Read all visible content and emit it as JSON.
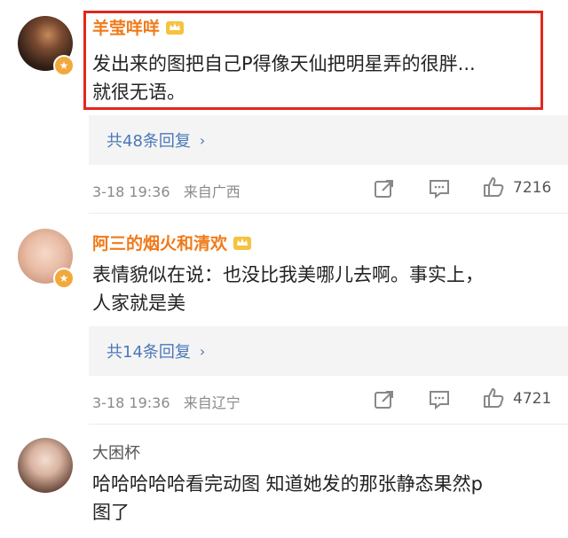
{
  "comments": [
    {
      "username": "羊莹咩咩",
      "text_lines": [
        "发出来的图把自己P得像天仙把明星弄的很胖...",
        "就很无语。"
      ],
      "replies_label": "共48条回复",
      "date": "3-18 19:36",
      "location": "来自广西",
      "likes": "7216"
    },
    {
      "username": "阿三的烟火和清欢",
      "text_lines": [
        "表情貌似在说：也没比我美哪儿去啊。事实上，",
        "人家就是美"
      ],
      "replies_label": "共14条回复",
      "date": "3-18 19:36",
      "location": "来自辽宁",
      "likes": "4721"
    },
    {
      "username": "大困杯",
      "text_lines": [
        "哈哈哈哈哈看完动图 知道她发的那张静态果然p",
        "图了"
      ]
    }
  ],
  "colors": {
    "username": "#f07a1a",
    "link": "#4a78b8",
    "highlight": "#e0281e",
    "meta": "#8a8a8a"
  },
  "icons": [
    "crown-icon",
    "share-icon",
    "comment-icon",
    "like-icon",
    "chevron-right-icon",
    "vip-badge-icon"
  ]
}
